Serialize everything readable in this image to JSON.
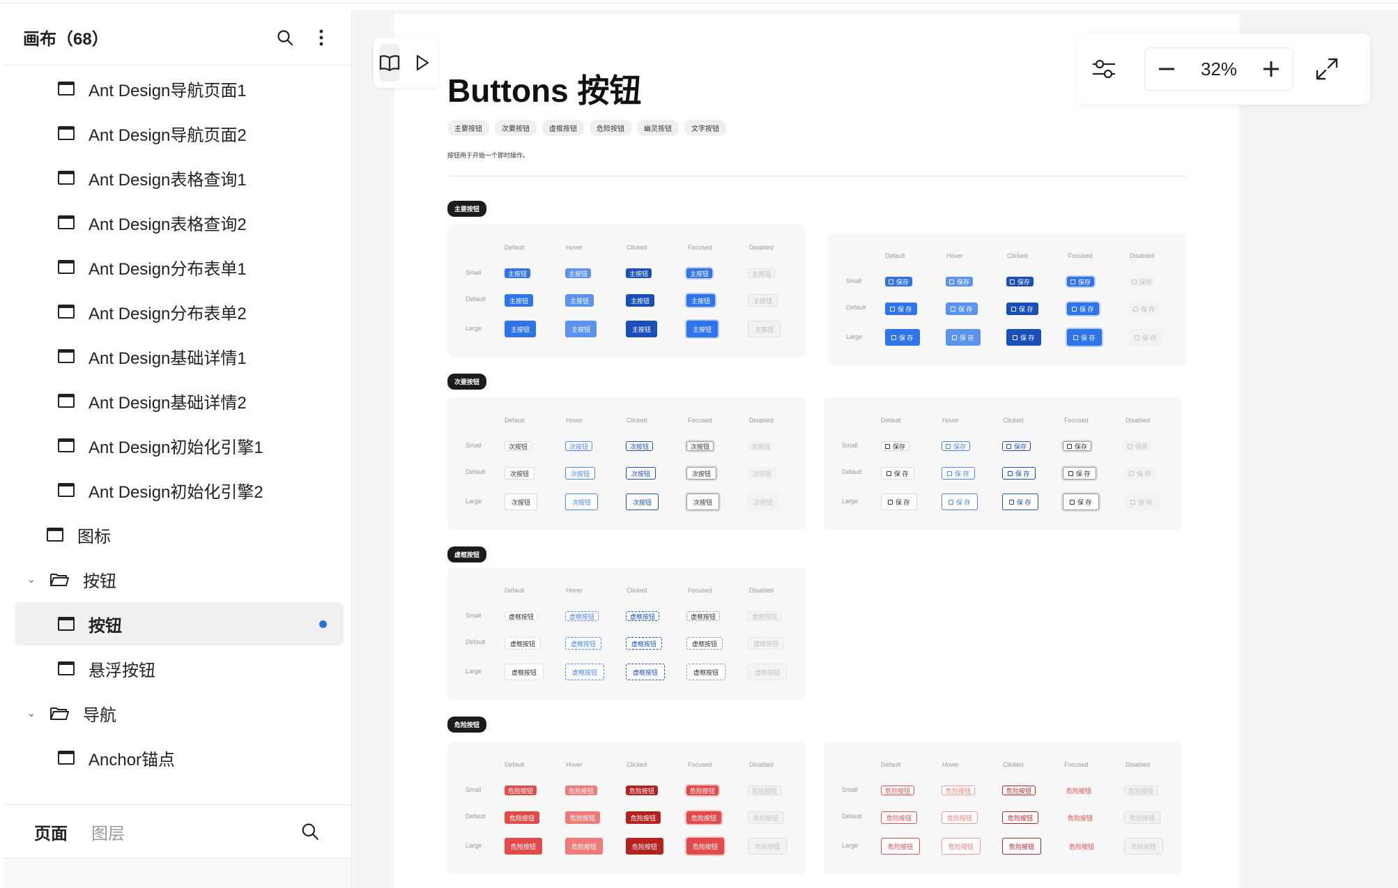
{
  "sidebar": {
    "title": "画布（68）",
    "items": [
      {
        "label": "Ant Design导航页面1",
        "type": "frame"
      },
      {
        "label": "Ant Design导航页面2",
        "type": "frame"
      },
      {
        "label": "Ant Design表格查询1",
        "type": "frame"
      },
      {
        "label": "Ant Design表格查询2",
        "type": "frame"
      },
      {
        "label": "Ant Design分布表单1",
        "type": "frame"
      },
      {
        "label": "Ant Design分布表单2",
        "type": "frame"
      },
      {
        "label": "Ant Design基础详情1",
        "type": "frame"
      },
      {
        "label": "Ant Design基础详情2",
        "type": "frame"
      },
      {
        "label": "Ant Design初始化引擎1",
        "type": "frame"
      },
      {
        "label": "Ant Design初始化引擎2",
        "type": "frame"
      },
      {
        "label": "图标",
        "type": "frame"
      },
      {
        "label": "按钮",
        "type": "folder"
      },
      {
        "label": "按钮",
        "type": "frame",
        "selected": true
      },
      {
        "label": "悬浮按钮",
        "type": "frame"
      },
      {
        "label": "导航",
        "type": "folder"
      },
      {
        "label": "Anchor锚点",
        "type": "frame"
      }
    ],
    "tabs": {
      "pages": "页面",
      "layers": "图层"
    }
  },
  "toolbar": {
    "zoom": "32%",
    "icons": [
      "book-icon",
      "play-icon",
      "settings-sliders-icon",
      "zoom-out-icon",
      "zoom-in-icon",
      "fullscreen-icon"
    ]
  },
  "artboard": {
    "title": "Buttons 按钮",
    "tags": [
      "主要按钮",
      "次要按钮",
      "虚框按钮",
      "危险按钮",
      "幽灵按钮",
      "文字按钮"
    ],
    "description": "按钮用于开始一个即时操作。",
    "states": [
      "Default",
      "Hover",
      "Clicked",
      "Focused",
      "Disabled"
    ],
    "sizes": [
      "Small",
      "Default",
      "Large"
    ],
    "sections": {
      "primary": {
        "pill": "主要按钮",
        "label": "主按钮",
        "icon_label": "保存",
        "icon_label_spaced": "保 存"
      },
      "secondary": {
        "pill": "次要按钮",
        "label": "次按钮",
        "icon_label": "保存",
        "icon_label_spaced": "保 存"
      },
      "dashed": {
        "pill": "虚框按钮",
        "label": "虚框按钮"
      },
      "danger": {
        "pill": "危险按钮",
        "label": "危险按钮"
      }
    }
  },
  "colors": {
    "primary": "#2f74ea",
    "primary_hover": "#5b93ef",
    "primary_clicked": "#1a4fb8",
    "danger": "#e24b4b",
    "selection_dot": "#2f6ee0"
  }
}
